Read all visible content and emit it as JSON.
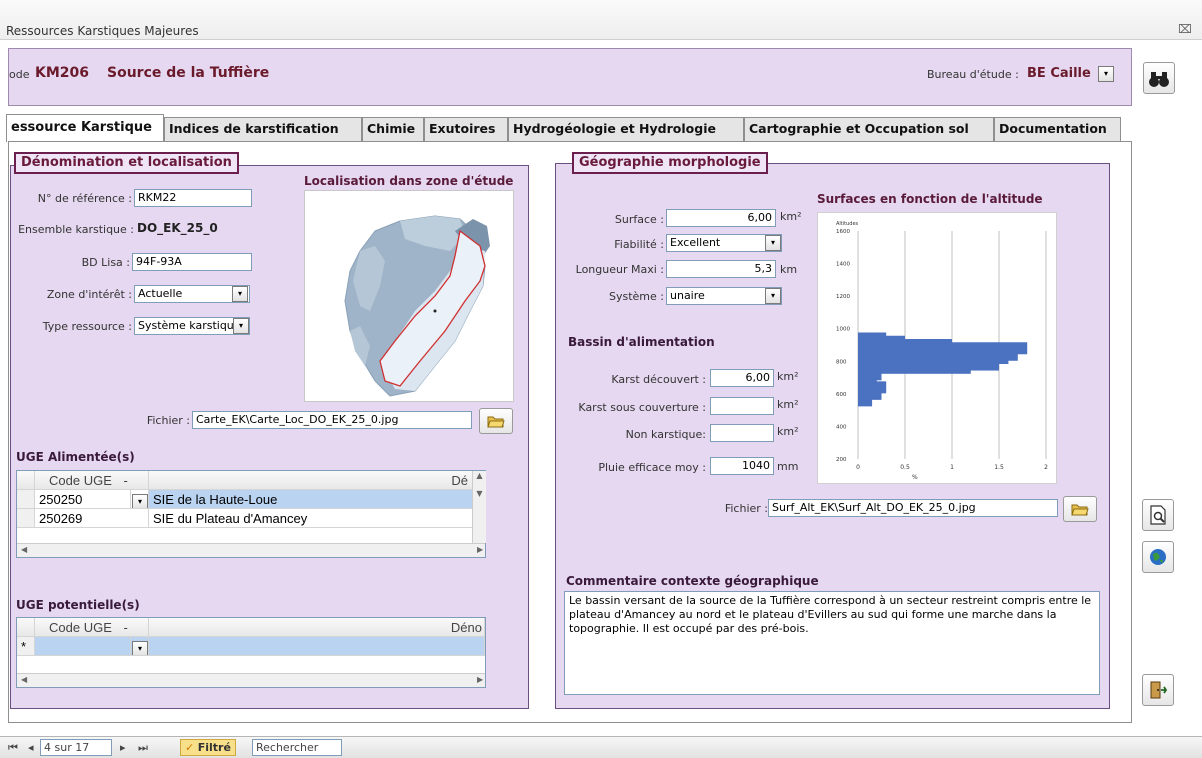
{
  "window": {
    "title": "Ressources Karstiques Majeures",
    "close_glyph": "⌧"
  },
  "header": {
    "code_label": "ode",
    "code": "KM206",
    "name": "Source de la Tuffière",
    "bureau_label": "Bureau d'étude :",
    "bureau_value": "BE Caille",
    "dropdown_glyph": "▾"
  },
  "toolbar": {
    "search_icon": "binoculars-icon",
    "preview_icon": "print-preview-icon",
    "globe_icon": "globe-icon",
    "exit_icon": "exit-door-icon"
  },
  "tabs": [
    {
      "label": "essource Karstique"
    },
    {
      "label": "Indices de karstification"
    },
    {
      "label": "Chimie"
    },
    {
      "label": "Exutoires"
    },
    {
      "label": "Hydrogéologie et  Hydrologie"
    },
    {
      "label": "Cartographie et Occupation sol"
    },
    {
      "label": "Documentation"
    }
  ],
  "denomination": {
    "legend": "Dénomination et localisation",
    "ref_label": "N° de référence :",
    "ref_value": "RKM22",
    "ensemble_label": "Ensemble karstique :",
    "ensemble_value": "DO_EK_25_0",
    "bdlisa_label": "BD Lisa :",
    "bdlisa_value": "94F-93A",
    "zone_label": "Zone d'intérêt :",
    "zone_value": "Actuelle",
    "type_label": "Type ressource :",
    "type_value": "Système karstiqu",
    "map_title": "Localisation dans zone d'étude",
    "fichier_label": "Fichier :",
    "fichier_value": "Carte_EK\\Carte_Loc_DO_EK_25_0.jpg"
  },
  "uge_alimentees": {
    "title": "UGE Alimentée(s)",
    "col_code": "Code UGE",
    "col_name": "Dé",
    "sort_glyph": "-",
    "rows": [
      {
        "code": "250250",
        "name": "SIE de la Haute-Loue"
      },
      {
        "code": "250269",
        "name": "SIE du Plateau d'Amancey"
      }
    ]
  },
  "uge_potentielles": {
    "title": "UGE potentielle(s)",
    "col_code": "Code UGE",
    "col_name": "Déno",
    "sort_glyph": "-",
    "new_row_marker": "*"
  },
  "geographie": {
    "legend": "Géographie morphologie",
    "surface_label": "Surface :",
    "surface_value": "6,00",
    "surface_unit": "km²",
    "fiabilite_label": "Fiabilité :",
    "fiabilite_value": "Excellent",
    "longueur_label": "Longueur Maxi :",
    "longueur_value": "5,3",
    "longueur_unit": "km",
    "systeme_label": "Système :",
    "systeme_value": "unaire",
    "bassin_title": "Bassin d'alimentation",
    "karst_dec_label": "Karst découvert :",
    "karst_dec_value": "6,00",
    "karst_sc_label": "Karst sous couverture :",
    "karst_sc_value": "",
    "non_karst_label": "Non karstique:",
    "non_karst_value": "",
    "pluie_label": "Pluie efficace moy :",
    "pluie_value": "1040",
    "pluie_unit": "mm",
    "km2_unit": "km²",
    "chart_title": "Surfaces en fonction de l'altitude",
    "fichier_label": "Fichier :",
    "fichier_value": "Surf_Alt_EK\\Surf_Alt_DO_EK_25_0.jpg",
    "comment_title": "Commentaire contexte géographique",
    "comment_text": "Le bassin versant de la source de la Tuffière correspond à un secteur restreint compris entre le plateau d'Amancey au nord et le plateau d'Evillers au sud qui forme une marche dans la topographie. Il est occupé par des pré-bois."
  },
  "chart_data": {
    "type": "bar",
    "title": "",
    "ylabel": "Altitudes",
    "xlabel": "%",
    "y_ticks": [
      "1600",
      "1400",
      "1200",
      "1000",
      "800",
      "600",
      "400",
      "200"
    ],
    "x_ticks": [
      "0",
      "0.5",
      "1",
      "1.5",
      "2"
    ],
    "ylim": [
      200,
      1600
    ],
    "xlim": [
      0,
      2
    ],
    "orientation": "horizontal",
    "altitudes": [
      560,
      600,
      640,
      680,
      720,
      760,
      780,
      800,
      820,
      840,
      860,
      880,
      900,
      920,
      940
    ],
    "values": [
      0.15,
      0.25,
      0.3,
      0.2,
      0.25,
      1.2,
      1.5,
      1.0,
      1.6,
      1.7,
      1.3,
      1.8,
      1.0,
      0.5,
      0.3
    ]
  },
  "statusbar": {
    "nav_first": "⏮",
    "nav_prev": "◂",
    "record": "4 sur 17",
    "nav_next": "▸",
    "nav_last": "⏭",
    "filter": "Filtré",
    "search": "Rechercher"
  }
}
